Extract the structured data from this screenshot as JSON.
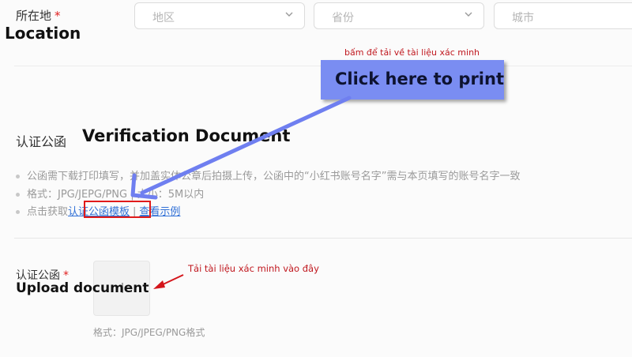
{
  "location": {
    "label_cn": "所在地",
    "required_mark": "*",
    "label_en": "Location",
    "district_placeholder": "地区",
    "province_placeholder": "省份",
    "city_placeholder": "城市"
  },
  "print_callout": {
    "vi_note": "bấm để tải về tài liệu xác minh",
    "button_label": "Click here to print"
  },
  "verification": {
    "label_cn": "认证公函",
    "label_en": "Verification Document",
    "note1": "公函需下载打印填写，并加盖实体公章后拍摄上传，公函中的“小红书账号名字”需与本页填写的账号名字一致",
    "note2": "格式：JPG/JEPG/PNG | 大小：5M以内",
    "note3_prefix": "点击获取",
    "template_link": "认证公函模板",
    "separator": "|",
    "example_link": "查看示例"
  },
  "upload": {
    "label_cn": "认证公函",
    "required_mark": "*",
    "label_en": "Upload document",
    "vi_note": "Tải tài liệu xác minh vào đây",
    "format_hint": "格式：JPG/JPEG/PNG格式"
  },
  "colors": {
    "accent_blue": "#7a8df2",
    "link_blue": "#2f6fd6",
    "annotation_red": "#e01a1a",
    "required_red": "#e02020"
  },
  "icons": [
    "chevron-down-icon",
    "arrow-icon"
  ]
}
